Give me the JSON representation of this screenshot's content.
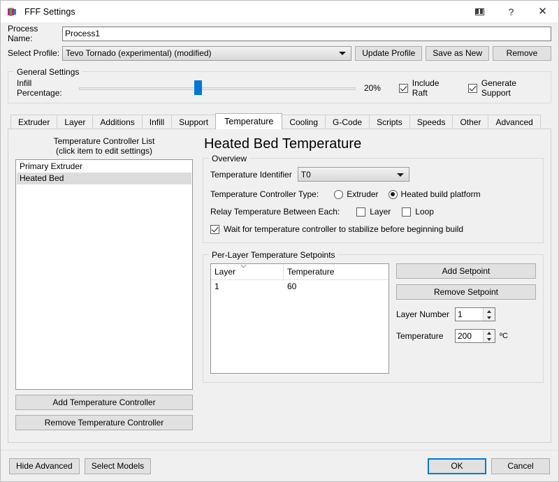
{
  "window": {
    "title": "FFF Settings",
    "icon": "fff-app-icon",
    "buttons": [
      {
        "name": "restore-window-button",
        "icon": "restore-icon",
        "label": ""
      },
      {
        "name": "help-button",
        "icon": "help-icon",
        "label": "?"
      },
      {
        "name": "close-button",
        "icon": "close-icon",
        "label": "✕"
      }
    ]
  },
  "top": {
    "process_name_label": "Process Name:",
    "process_name_value": "Process1",
    "process_name_placeholder": "Process1",
    "select_profile_label": "Select Profile:",
    "select_profile_value": "Tevo Tornado (experimental) (modified)",
    "update_profile_label": "Update Profile",
    "save_as_new_label": "Save as New",
    "remove_label": "Remove"
  },
  "general_settings": {
    "title": "General Settings",
    "infill_label": "Infill Percentage:",
    "infill_value": "20%",
    "infill_percent": 20,
    "include_raft_label": "Include Raft",
    "include_raft_checked": true,
    "generate_support_label": "Generate Support",
    "generate_support_checked": true
  },
  "tabs": [
    {
      "label": "Extruder",
      "active": false
    },
    {
      "label": "Layer",
      "active": false
    },
    {
      "label": "Additions",
      "active": false
    },
    {
      "label": "Infill",
      "active": false
    },
    {
      "label": "Support",
      "active": false
    },
    {
      "label": "Temperature",
      "active": true
    },
    {
      "label": "Cooling",
      "active": false
    },
    {
      "label": "G-Code",
      "active": false
    },
    {
      "label": "Scripts",
      "active": false
    },
    {
      "label": "Speeds",
      "active": false
    },
    {
      "label": "Other",
      "active": false
    },
    {
      "label": "Advanced",
      "active": false
    }
  ],
  "left_panel": {
    "caption_line1": "Temperature Controller List",
    "caption_line2": "(click item to edit settings)",
    "items": [
      {
        "label": "Primary Extruder",
        "selected": false
      },
      {
        "label": "Heated Bed",
        "selected": true
      }
    ],
    "add_button": "Add Temperature Controller",
    "remove_button": "Remove Temperature Controller"
  },
  "right_panel": {
    "page_title": "Heated Bed Temperature",
    "overview": {
      "title": "Overview",
      "identifier_label": "Temperature Identifier",
      "identifier_value": "T0",
      "controller_type_label": "Temperature Controller Type:",
      "type_extruder_label": "Extruder",
      "type_extruder_selected": false,
      "type_platform_label": "Heated build platform",
      "type_platform_selected": true,
      "relay_label": "Relay Temperature Between Each:",
      "relay_layer_label": "Layer",
      "relay_layer_checked": false,
      "relay_loop_label": "Loop",
      "relay_loop_checked": false,
      "wait_label": "Wait for temperature controller to stabilize before beginning build",
      "wait_checked": true
    },
    "setpoints": {
      "title": "Per-Layer Temperature Setpoints",
      "columns": [
        "Layer",
        "Temperature"
      ],
      "rows": [
        {
          "layer": "1",
          "temperature": "60"
        }
      ],
      "add_button": "Add Setpoint",
      "remove_button": "Remove Setpoint",
      "layer_number_label": "Layer Number",
      "layer_number_value": "1",
      "temperature_label": "Temperature",
      "temperature_value": "200",
      "temperature_unit": "ºC"
    }
  },
  "footer": {
    "hide_advanced_label": "Hide Advanced",
    "select_models_label": "Select Models",
    "ok_label": "OK",
    "cancel_label": "Cancel"
  },
  "colors": {
    "accent": "#0078d7",
    "window_bg": "#f0f0f0",
    "selection": "#dcdcdc"
  }
}
